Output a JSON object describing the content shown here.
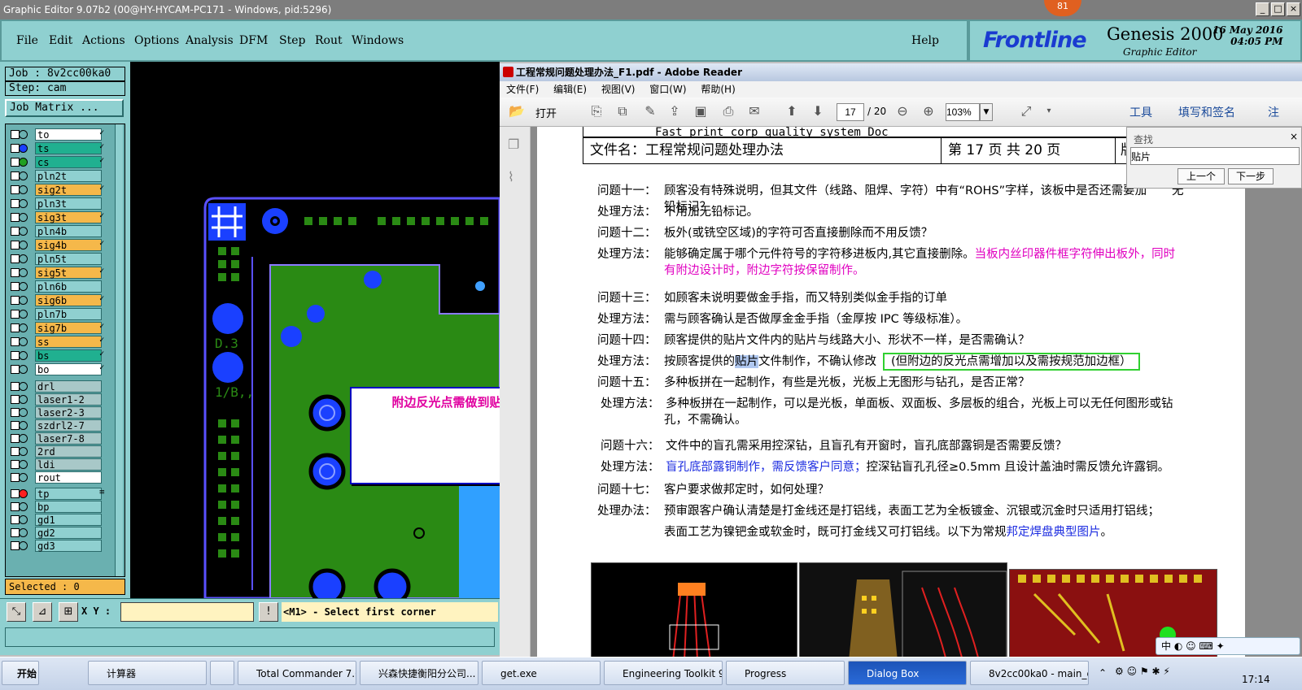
{
  "genesis": {
    "title": "Graphic Editor 9.07b2 (00@HY-HYCAM-PC171 - Windows, pid:5296)",
    "menu": [
      "File",
      "Edit",
      "Actions",
      "Options",
      "Analysis",
      "DFM",
      "Step",
      "Rout",
      "Windows"
    ],
    "help": "Help",
    "badge": "81",
    "brand": {
      "logo": "Frontline",
      "product": "Genesis 2000",
      "subtitle": "Graphic Editor",
      "date": "16 May 2016",
      "time": "04:05 PM"
    },
    "job": "Job : 8v2cc00ka0",
    "step": "Step: cam",
    "job_matrix": "Job Matrix ...",
    "layers": [
      {
        "name": "to",
        "bg": "#ffffff",
        "dot": "",
        "mark": "✓"
      },
      {
        "name": "ts",
        "bg": "#20b090",
        "dot": "#1a40ff",
        "mark": "✓"
      },
      {
        "name": "cs",
        "bg": "#20b090",
        "dot": "#20a020",
        "mark": "✓"
      },
      {
        "name": "pln2t",
        "bg": "#8fd0d0",
        "dot": "",
        "mark": ""
      },
      {
        "name": "sig2t",
        "bg": "#f5b84a",
        "dot": "",
        "mark": "✓"
      },
      {
        "name": "pln3t",
        "bg": "#8fd0d0",
        "dot": "",
        "mark": ""
      },
      {
        "name": "sig3t",
        "bg": "#f5b84a",
        "dot": "",
        "mark": "✓"
      },
      {
        "name": "pln4b",
        "bg": "#8fd0d0",
        "dot": "",
        "mark": ""
      },
      {
        "name": "sig4b",
        "bg": "#f5b84a",
        "dot": "",
        "mark": "✓"
      },
      {
        "name": "pln5t",
        "bg": "#8fd0d0",
        "dot": "",
        "mark": ""
      },
      {
        "name": "sig5t",
        "bg": "#f5b84a",
        "dot": "",
        "mark": "✓"
      },
      {
        "name": "pln6b",
        "bg": "#8fd0d0",
        "dot": "",
        "mark": ""
      },
      {
        "name": "sig6b",
        "bg": "#f5b84a",
        "dot": "",
        "mark": "✓"
      },
      {
        "name": "pln7b",
        "bg": "#8fd0d0",
        "dot": "",
        "mark": ""
      },
      {
        "name": "sig7b",
        "bg": "#f5b84a",
        "dot": "",
        "mark": "✓"
      },
      {
        "name": "ss",
        "bg": "#f5b84a",
        "dot": "",
        "mark": "✓"
      },
      {
        "name": "bs",
        "bg": "#20b090",
        "dot": "",
        "mark": "✓"
      },
      {
        "name": "bo",
        "bg": "#ffffff",
        "dot": "",
        "mark": "✓"
      },
      {
        "name": "drl",
        "bg": "#a8c8c8",
        "dot": "",
        "mark": ""
      },
      {
        "name": "laser1-2",
        "bg": "#a8c8c8",
        "dot": "",
        "mark": ""
      },
      {
        "name": "laser2-3",
        "bg": "#a8c8c8",
        "dot": "",
        "mark": ""
      },
      {
        "name": "szdrl2-7",
        "bg": "#a8c8c8",
        "dot": "",
        "mark": ""
      },
      {
        "name": "laser7-8",
        "bg": "#a8c8c8",
        "dot": "",
        "mark": ""
      },
      {
        "name": "2rd",
        "bg": "#a8c8c8",
        "dot": "",
        "mark": ""
      },
      {
        "name": "ldi",
        "bg": "#a8c8c8",
        "dot": "",
        "mark": ""
      },
      {
        "name": "rout",
        "bg": "#ffffff",
        "dot": "",
        "mark": ""
      },
      {
        "name": "tp",
        "bg": "#8fd0d0",
        "dot": "#ff2020",
        "mark": "≡"
      },
      {
        "name": "bp",
        "bg": "#8fd0d0",
        "dot": "",
        "mark": ""
      },
      {
        "name": "gd1",
        "bg": "#8fd0d0",
        "dot": "",
        "mark": ""
      },
      {
        "name": "gd2",
        "bg": "#8fd0d0",
        "dot": "",
        "mark": ""
      },
      {
        "name": "gd3",
        "bg": "#8fd0d0",
        "dot": "",
        "mark": ""
      }
    ],
    "selected": "Selected : 0",
    "xy_label": "X Y :",
    "xy_value": "",
    "status_msg": "<M1> - Select first corner",
    "board_text": [
      "D.3",
      "1/B,,"
    ],
    "note": "附边反光点需做到贴片层"
  },
  "reader": {
    "title": "工程常规问题处理办法_F1.pdf - Adobe Reader",
    "menu": [
      "文件(F)",
      "编辑(E)",
      "视图(V)",
      "窗口(W)",
      "帮助(H)"
    ],
    "open": "打开",
    "page_current": "17",
    "page_total": "/ 20",
    "zoom": "103%",
    "tools": "工具",
    "sign": "填写和签名",
    "comment": "注",
    "find": {
      "label": "查找",
      "value": "贴片",
      "prev": "上一个",
      "next": "下一步"
    },
    "header": {
      "top": "Fast print corp quality system Doc",
      "filename": "文件名：工程常规问题处理办法",
      "page": "第 17 页 共 20 页",
      "right": "版"
    },
    "lines": [
      {
        "q": "问题十一：",
        "t": "顾客没有特殊说明，但其文件（线路、阻焊、字符）中有“ROHS”字样，该板中是否还需要加",
        "t2": "铅标记？",
        "tail": "无"
      },
      {
        "q": "处理方法：",
        "t": "不用加无铅标记。"
      },
      {
        "q": "问题十二：",
        "t": "板外(或铣空区域)的字符可否直接删除而不用反馈？"
      },
      {
        "q": "处理方法：",
        "t": "能够确定属于哪个元件符号的字符移进板内,其它直接删除。",
        "m": "当板内丝印器件框字符伸出板外，同时",
        "m2": "有附边设计时，附边字符按保留制作。"
      },
      {
        "q": "问题十三：",
        "t": "如顾客未说明要做金手指，而又特别类似金手指的订单"
      },
      {
        "q": "处理方法：",
        "t": "需与顾客确认是否做厚金金手指（金厚按 IPC 等级标准）。"
      },
      {
        "q": "问题十四：",
        "t": "顾客提供的贴片文件内的贴片与线路大小、形状不一样，是否需确认？"
      },
      {
        "q": "处理方法：",
        "t": "按顾客提供的",
        "h": "贴片",
        "t3": "文件制作，不确认修改",
        "box": "(但附边的反光点需增加以及需按规范加边框）"
      },
      {
        "q": "问题十五：",
        "t": "多种板拼在一起制作，有些是光板，光板上无图形与钻孔，是否正常？"
      },
      {
        "q": "处理方法：",
        "t": "多种板拼在一起制作，可以是光板，单面板、双面板、多层板的组合，光板上可以无任何图形或钻",
        "t2": "孔，不需确认。"
      },
      {
        "q": "问题十六：",
        "t": "文件中的盲孔需采用控深钻，且盲孔有开窗时，盲孔底部露铜是否需要反馈？"
      },
      {
        "q": "处理方法：",
        "b": "盲孔底部露铜制作，需反馈客户同意；",
        "t": "控深钻盲孔孔径≥0.5mm 且设计盖油时需反馈允许露铜。"
      },
      {
        "q": "问题十七：",
        "t": "客户要求做邦定时，如何处理？"
      },
      {
        "q": "处理办法：",
        "t": "预审跟客户确认清楚是打金线还是打铝线，表面工艺为全板镀金、沉银或沉金时只适用打铝线；",
        "t2": "表面工艺为镍钯金或软金时，既可打金线又可打铝线。以下为常规",
        "b2": "邦定焊盘典型图片",
        "t4": "。"
      }
    ],
    "ime": "中"
  },
  "taskbar": {
    "start": "开始",
    "items": [
      "计算器",
      "",
      "Total Commander 7.0 ...",
      "兴森快捷衡阳分公司...",
      "get.exe",
      "Engineering Toolkit 9.0...",
      "Progress",
      "Dialog Box",
      "8v2cc00ka0 - main_qa"
    ],
    "clock": "17:14"
  }
}
